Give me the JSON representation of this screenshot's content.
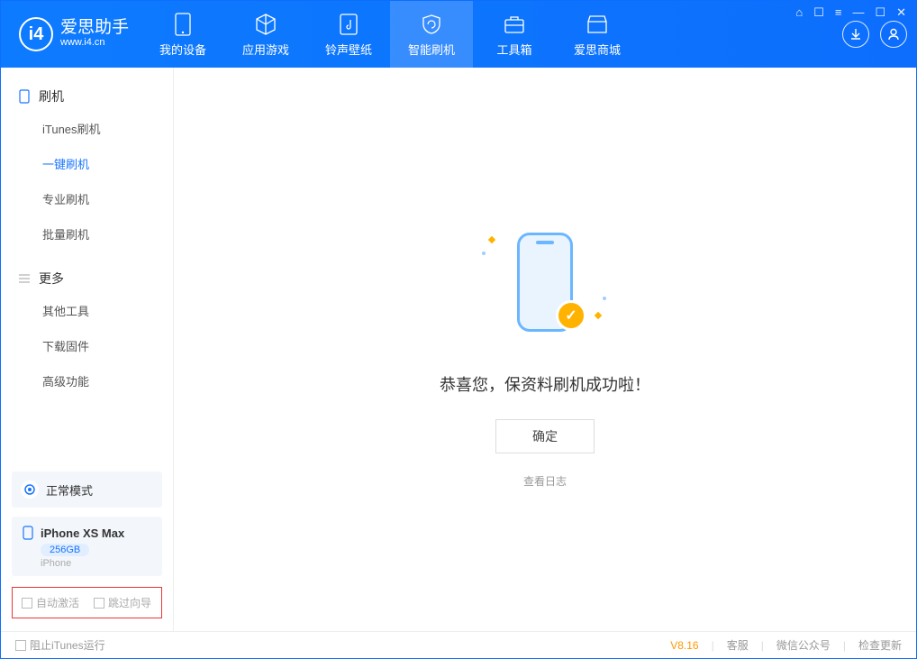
{
  "app": {
    "name": "爱思助手",
    "url": "www.i4.cn"
  },
  "nav": [
    {
      "label": "我的设备"
    },
    {
      "label": "应用游戏"
    },
    {
      "label": "铃声壁纸"
    },
    {
      "label": "智能刷机"
    },
    {
      "label": "工具箱"
    },
    {
      "label": "爱思商城"
    }
  ],
  "sidebar": {
    "section1_title": "刷机",
    "items1": [
      {
        "label": "iTunes刷机"
      },
      {
        "label": "一键刷机"
      },
      {
        "label": "专业刷机"
      },
      {
        "label": "批量刷机"
      }
    ],
    "section2_title": "更多",
    "items2": [
      {
        "label": "其他工具"
      },
      {
        "label": "下载固件"
      },
      {
        "label": "高级功能"
      }
    ],
    "mode_label": "正常模式",
    "device_name": "iPhone XS Max",
    "device_capacity": "256GB",
    "device_type": "iPhone",
    "cb_auto_activate": "自动激活",
    "cb_skip_guide": "跳过向导"
  },
  "main": {
    "success_message": "恭喜您，保资料刷机成功啦！",
    "ok_button": "确定",
    "view_log": "查看日志"
  },
  "footer": {
    "block_itunes": "阻止iTunes运行",
    "version": "V8.16",
    "support": "客服",
    "wechat": "微信公众号",
    "update": "检查更新"
  }
}
